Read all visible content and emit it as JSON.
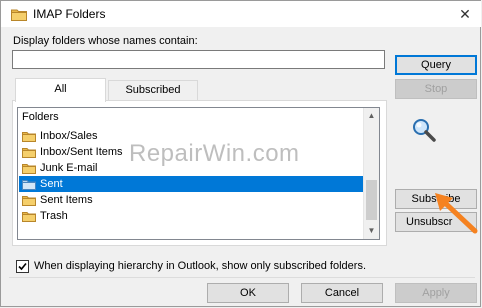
{
  "window": {
    "title": "IMAP Folders",
    "close_glyph": "✕"
  },
  "filter": {
    "label": "Display folders whose names contain:",
    "value": "",
    "placeholder": ""
  },
  "tabs": [
    {
      "label": "All",
      "active": true
    },
    {
      "label": "Subscribed",
      "active": false
    }
  ],
  "list": {
    "header": "Folders",
    "items": [
      {
        "label": "Inbox/Sales",
        "selected": false
      },
      {
        "label": "Inbox/Sent Items",
        "selected": false
      },
      {
        "label": "Junk E-mail",
        "selected": false
      },
      {
        "label": "Sent",
        "selected": true
      },
      {
        "label": "Sent Items",
        "selected": false
      },
      {
        "label": "Trash",
        "selected": false
      }
    ]
  },
  "buttons": {
    "query": "Query",
    "stop": "Stop",
    "subscribe": "Subscribe",
    "unsubscribe": "Unsubscr",
    "ok": "OK",
    "cancel": "Cancel",
    "apply": "Apply"
  },
  "checkbox": {
    "label": "When displaying hierarchy in Outlook, show only subscribed folders.",
    "checked": true
  },
  "watermark": "RepairWin.com",
  "icons": {
    "folder": "folder-icon",
    "search": "magnifier-icon",
    "arrow": "orange-arrow-annotation"
  },
  "colors": {
    "selection": "#0078d7",
    "folder": "#e8b84a",
    "arrow": "#f58220",
    "accent_border": "#0078d7"
  }
}
